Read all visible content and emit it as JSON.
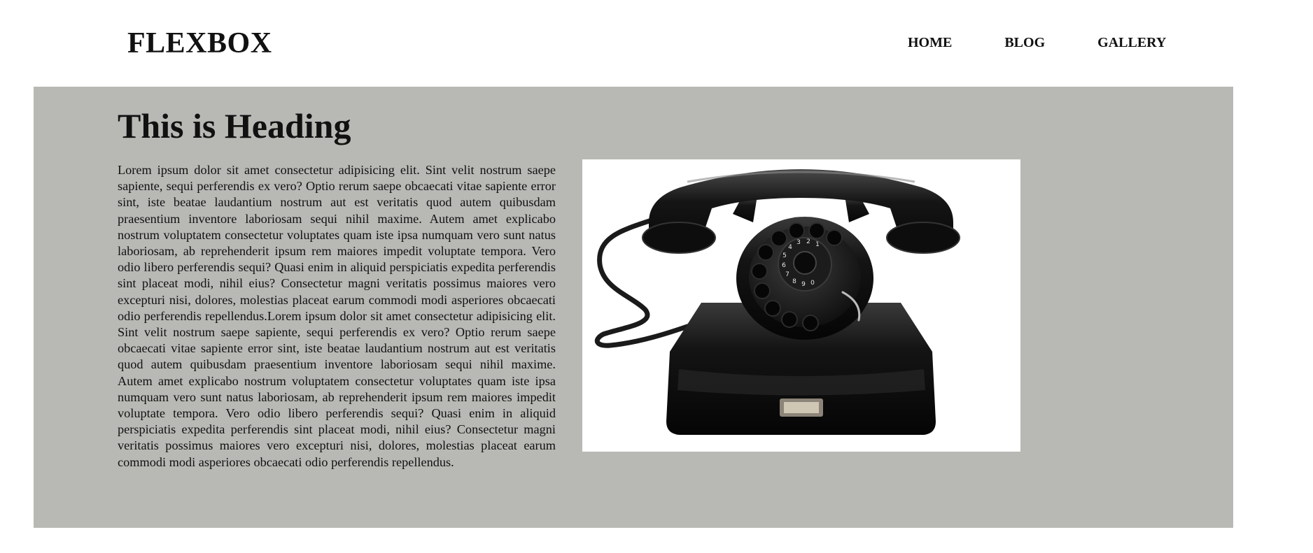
{
  "header": {
    "logo": "FLEXBOX",
    "nav": [
      {
        "label": "HOME"
      },
      {
        "label": "BLOG"
      },
      {
        "label": "GALLERY"
      }
    ]
  },
  "hero": {
    "heading": "This is Heading",
    "body": "Lorem ipsum dolor sit amet consectetur adipisicing elit. Sint velit nostrum saepe sapiente, sequi perferendis ex vero? Optio rerum saepe obcaecati vitae sapiente error sint, iste beatae laudantium nostrum aut est veritatis quod autem quibusdam praesentium inventore laboriosam sequi nihil maxime. Autem amet explicabo nostrum voluptatem consectetur voluptates quam iste ipsa numquam vero sunt natus laboriosam, ab reprehenderit ipsum rem maiores impedit voluptate tempora. Vero odio libero perferendis sequi? Quasi enim in aliquid perspiciatis expedita perferendis sint placeat modi, nihil eius? Consectetur magni veritatis possimus maiores vero excepturi nisi, dolores, molestias placeat earum commodi modi asperiores obcaecati odio perferendis repellendus.Lorem ipsum dolor sit amet consectetur adipisicing elit. Sint velit nostrum saepe sapiente, sequi perferendis ex vero? Optio rerum saepe obcaecati vitae sapiente error sint, iste beatae laudantium nostrum aut est veritatis quod autem quibusdam praesentium inventore laboriosam sequi nihil maxime. Autem amet explicabo nostrum voluptatem consectetur voluptates quam iste ipsa numquam vero sunt natus laboriosam, ab reprehenderit ipsum rem maiores impedit voluptate tempora. Vero odio libero perferendis sequi? Quasi enim in aliquid perspiciatis expedita perferendis sint placeat modi, nihil eius? Consectetur magni veritatis possimus maiores vero excepturi nisi, dolores, molestias placeat earum commodi modi asperiores obcaecati odio perferendis repellendus.",
    "image": {
      "icon": "rotary-telephone-image",
      "dial_numbers": [
        "1",
        "2",
        "3",
        "4",
        "5",
        "6",
        "7",
        "8",
        "9",
        "0"
      ]
    }
  },
  "colors": {
    "hero_background": "#b8b9b5",
    "image_background": "#ffffff",
    "phone_body": "#111111",
    "text": "#111111"
  }
}
